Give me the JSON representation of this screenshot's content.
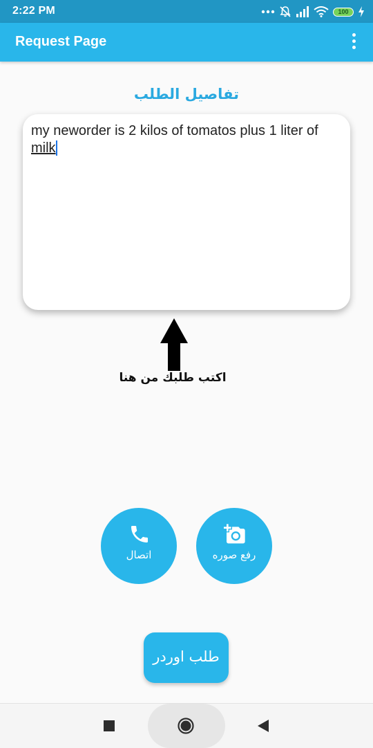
{
  "status_bar": {
    "time": "2:22 PM",
    "battery_level": "100",
    "icons": [
      "more-dots-icon",
      "bell-off-icon",
      "signal-icon",
      "wifi-icon",
      "battery-icon",
      "charging-bolt-icon"
    ]
  },
  "app_bar": {
    "title": "Request Page",
    "menu_icon": "more-vertical-icon"
  },
  "main": {
    "section_title": "تفاصيل الطلب",
    "order_text_prefix": "my neworder is 2 kilos of tomatos plus 1 liter of ",
    "order_text_last_word": "milk",
    "hint": "اكتب طلبك من هنا",
    "hint_icon": "arrow-up-icon"
  },
  "actions": {
    "call_label": "اتصال",
    "call_icon": "phone-icon",
    "upload_label": "رفع صوره",
    "upload_icon": "add-photo-icon",
    "order_label": "طلب اوردر"
  },
  "nav_bar": {
    "icons": [
      "recent-apps-icon",
      "home-icon",
      "back-icon"
    ]
  },
  "colors": {
    "status_bar": "#2196c4",
    "app_bar": "#29b6ea",
    "accent": "#2aa9e0",
    "background": "#fafafa"
  }
}
